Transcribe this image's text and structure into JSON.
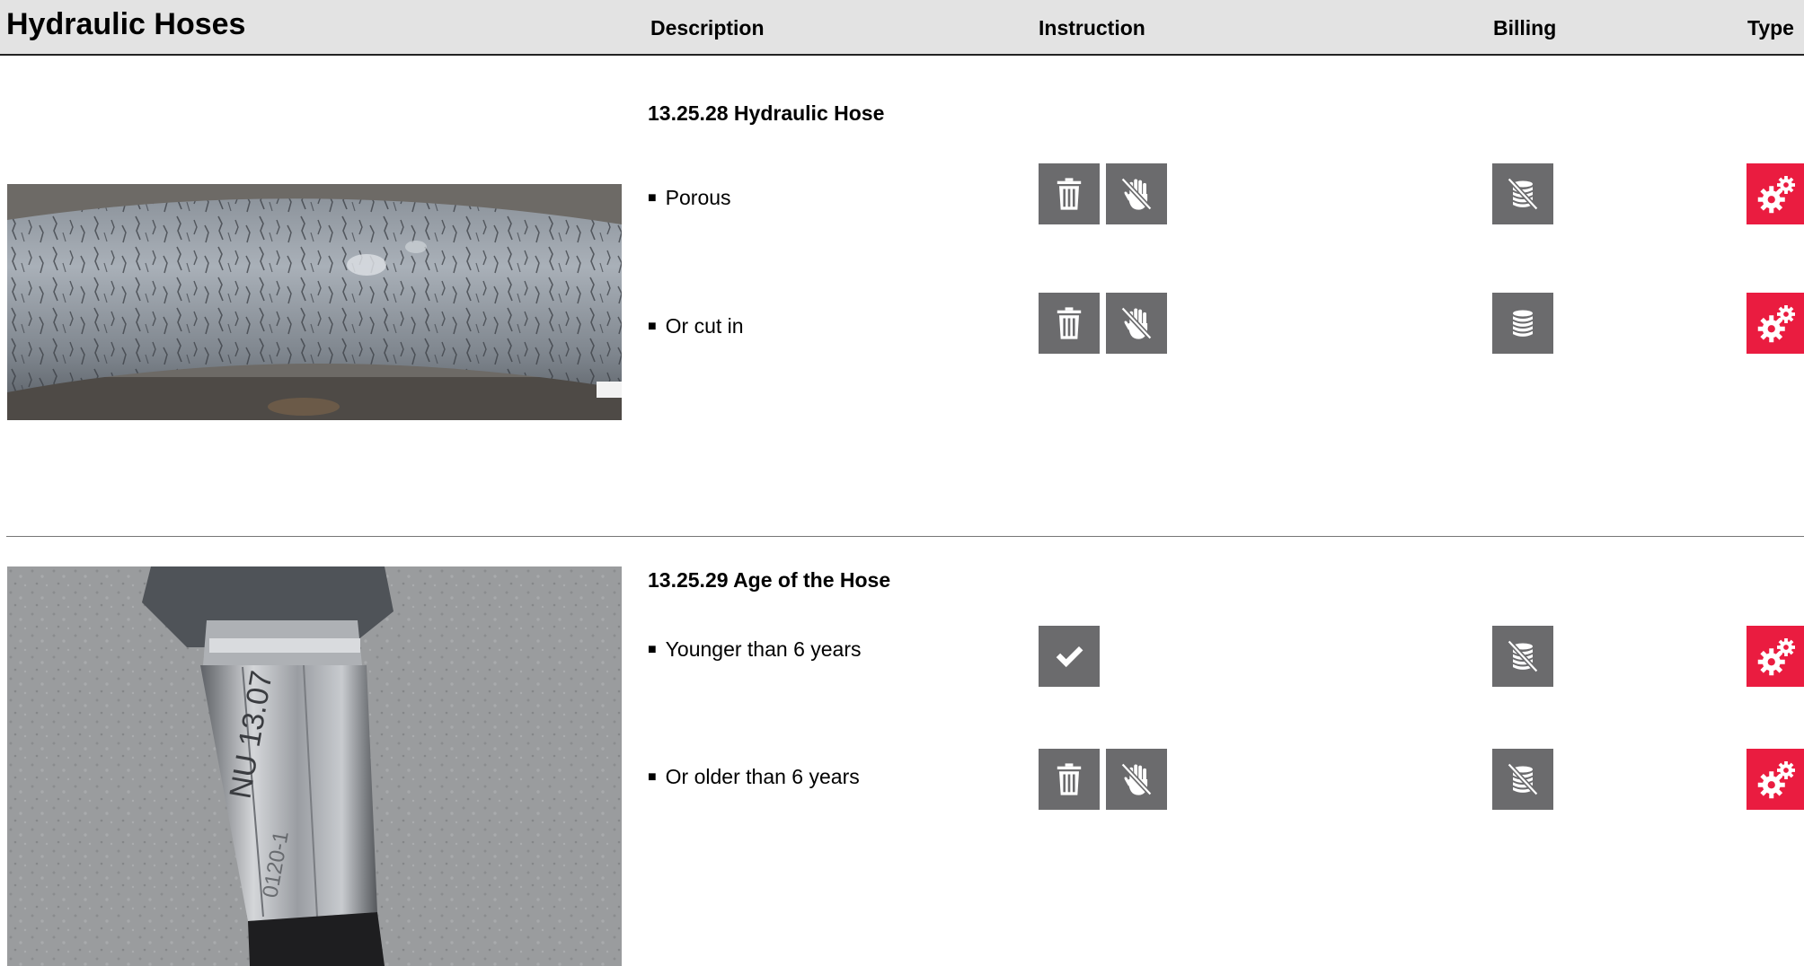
{
  "header": {
    "title": "Hydraulic Hoses",
    "columns": {
      "description": "Description",
      "instruction": "Instruction",
      "billing": "Billing",
      "type": "Type"
    }
  },
  "sections": [
    {
      "title": "13.25.28 Hydraulic Hose",
      "photo": "cracked-hose-photo",
      "items": [
        {
          "bullet": "■",
          "label": "Porous",
          "instruction_icons": [
            "trash-icon",
            "no-touch-icon"
          ],
          "billing_icon": "no-billing-icon",
          "type_icon": "gears-icon"
        },
        {
          "bullet": "■",
          "label": "Or cut in",
          "instruction_icons": [
            "trash-icon",
            "no-touch-icon"
          ],
          "billing_icon": "billing-icon",
          "type_icon": "gears-icon"
        }
      ]
    },
    {
      "title": "13.25.29 Age of the Hose",
      "photo": "hose-fitting-photo",
      "photo_text": [
        "NU 13.07",
        "0120-1"
      ],
      "items": [
        {
          "bullet": "■",
          "label": "Younger than 6 years",
          "instruction_icons": [
            "check-icon"
          ],
          "billing_icon": "no-billing-icon",
          "type_icon": "gears-icon"
        },
        {
          "bullet": "■",
          "label": "Or older than 6 years",
          "instruction_icons": [
            "trash-icon",
            "no-touch-icon"
          ],
          "billing_icon": "no-billing-icon",
          "type_icon": "gears-icon"
        }
      ]
    }
  ],
  "colors": {
    "icon_gray": "#6b6b6d",
    "type_red": "#ea1c40",
    "header_bg": "#e3e3e3"
  }
}
